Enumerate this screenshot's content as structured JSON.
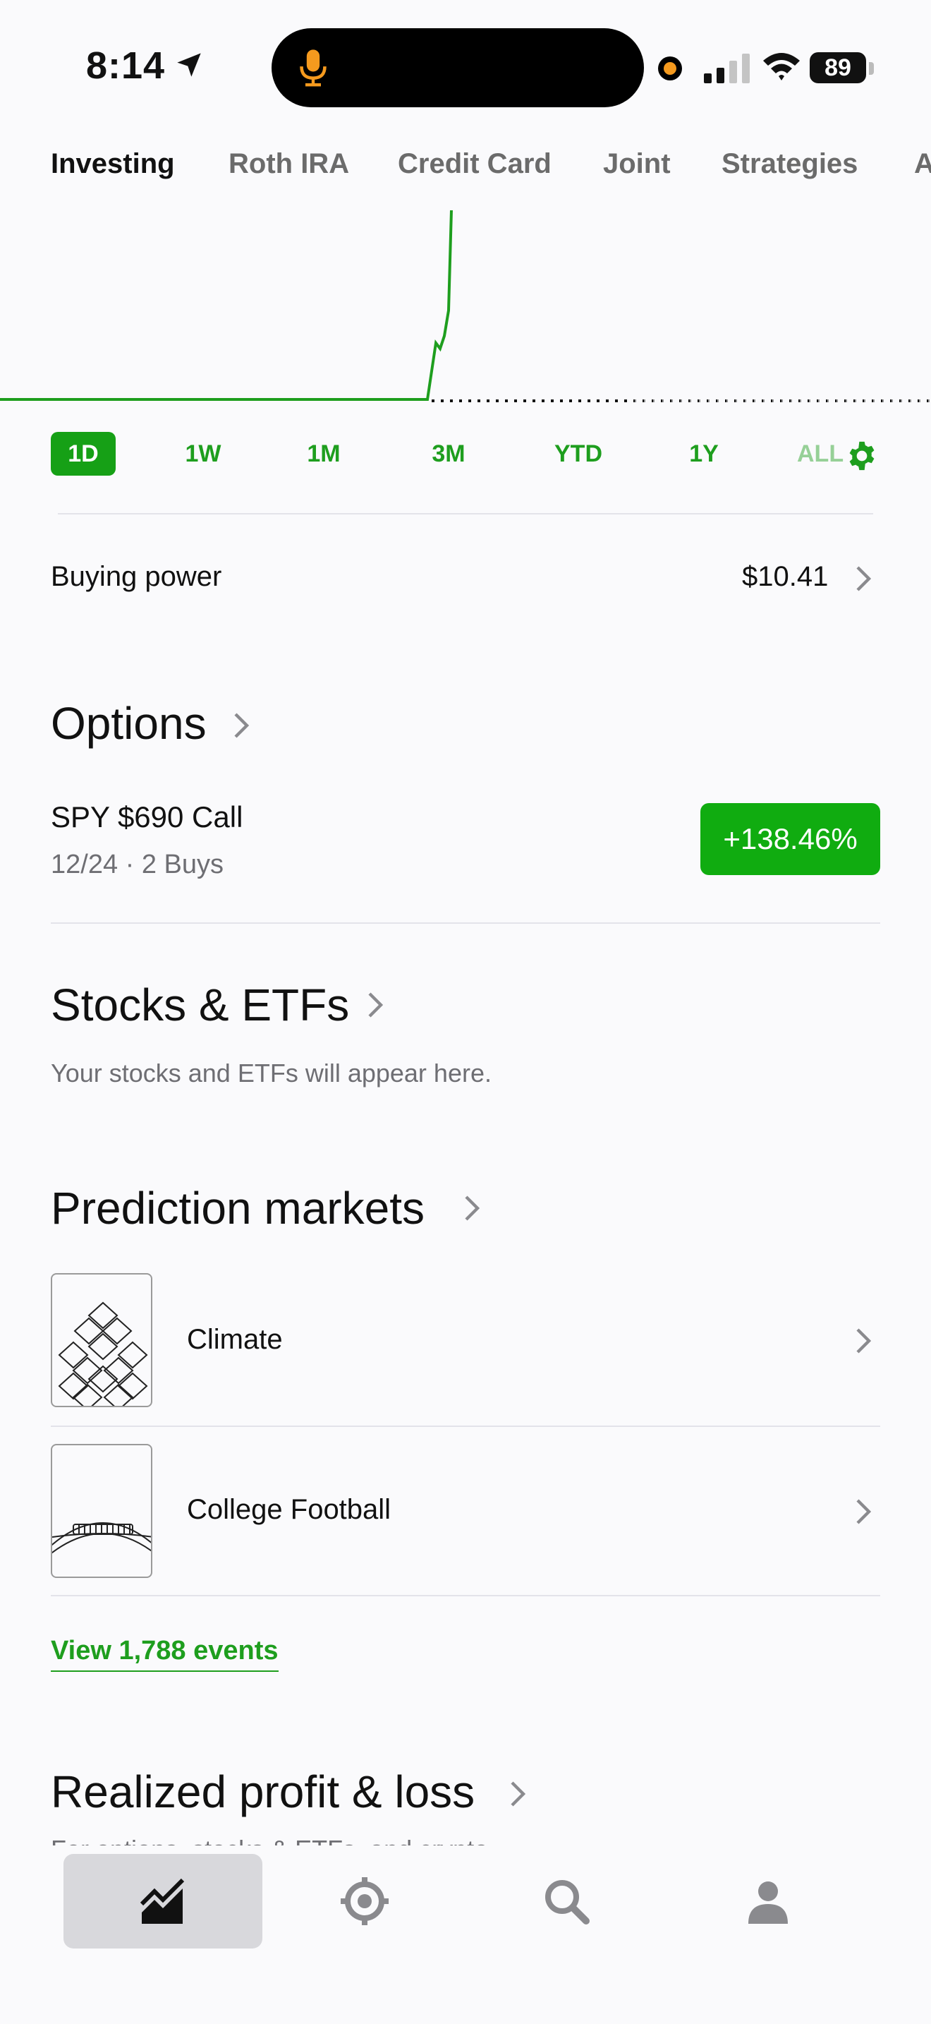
{
  "status_bar": {
    "time": "8:14",
    "battery": "89",
    "icons": [
      "location-arrow-icon",
      "microphone-icon",
      "recording-dot-icon",
      "cellular-signal-icon",
      "wifi-icon",
      "battery-icon"
    ],
    "accent_colors": {
      "mic": "#f59a1e",
      "recording_dot": "#f59a1e"
    }
  },
  "account_tabs": [
    "Investing",
    "Roth IRA",
    "Credit Card",
    "Joint",
    "Strategies",
    "A"
  ],
  "chart": {
    "color": "#1e9e1e",
    "baseline_style": "dotted"
  },
  "range_selector": {
    "options": [
      "1D",
      "1W",
      "1M",
      "3M",
      "YTD",
      "1Y",
      "ALL"
    ],
    "selected": "1D",
    "settings_icon": "gear-icon"
  },
  "buying_power": {
    "label": "Buying power",
    "value": "$10.41"
  },
  "options": {
    "title": "Options",
    "position": {
      "name": "SPY $690 Call",
      "detail": "12/24 · 2 Buys",
      "change": "+138.46%"
    }
  },
  "stocks": {
    "title": "Stocks & ETFs",
    "empty_text": "Your stocks and ETFs will appear here."
  },
  "prediction_markets": {
    "title": "Prediction markets",
    "items": [
      {
        "label": "Climate",
        "icon": "climate-diamonds-icon"
      },
      {
        "label": "College Football",
        "icon": "football-icon"
      }
    ],
    "view_events": "View 1,788 events"
  },
  "realized": {
    "title": "Realized profit & loss",
    "subtitle": "For options, stocks & ETFs, and crypto"
  },
  "bottom_nav": [
    {
      "name": "investing",
      "icon": "chart-icon",
      "active": true
    },
    {
      "name": "browse",
      "icon": "target-icon",
      "active": false
    },
    {
      "name": "search",
      "icon": "search-icon",
      "active": false
    },
    {
      "name": "account",
      "icon": "person-icon",
      "active": false
    }
  ],
  "colors": {
    "brand_green": "#1e9e1e",
    "badge_green": "#10ac10"
  }
}
